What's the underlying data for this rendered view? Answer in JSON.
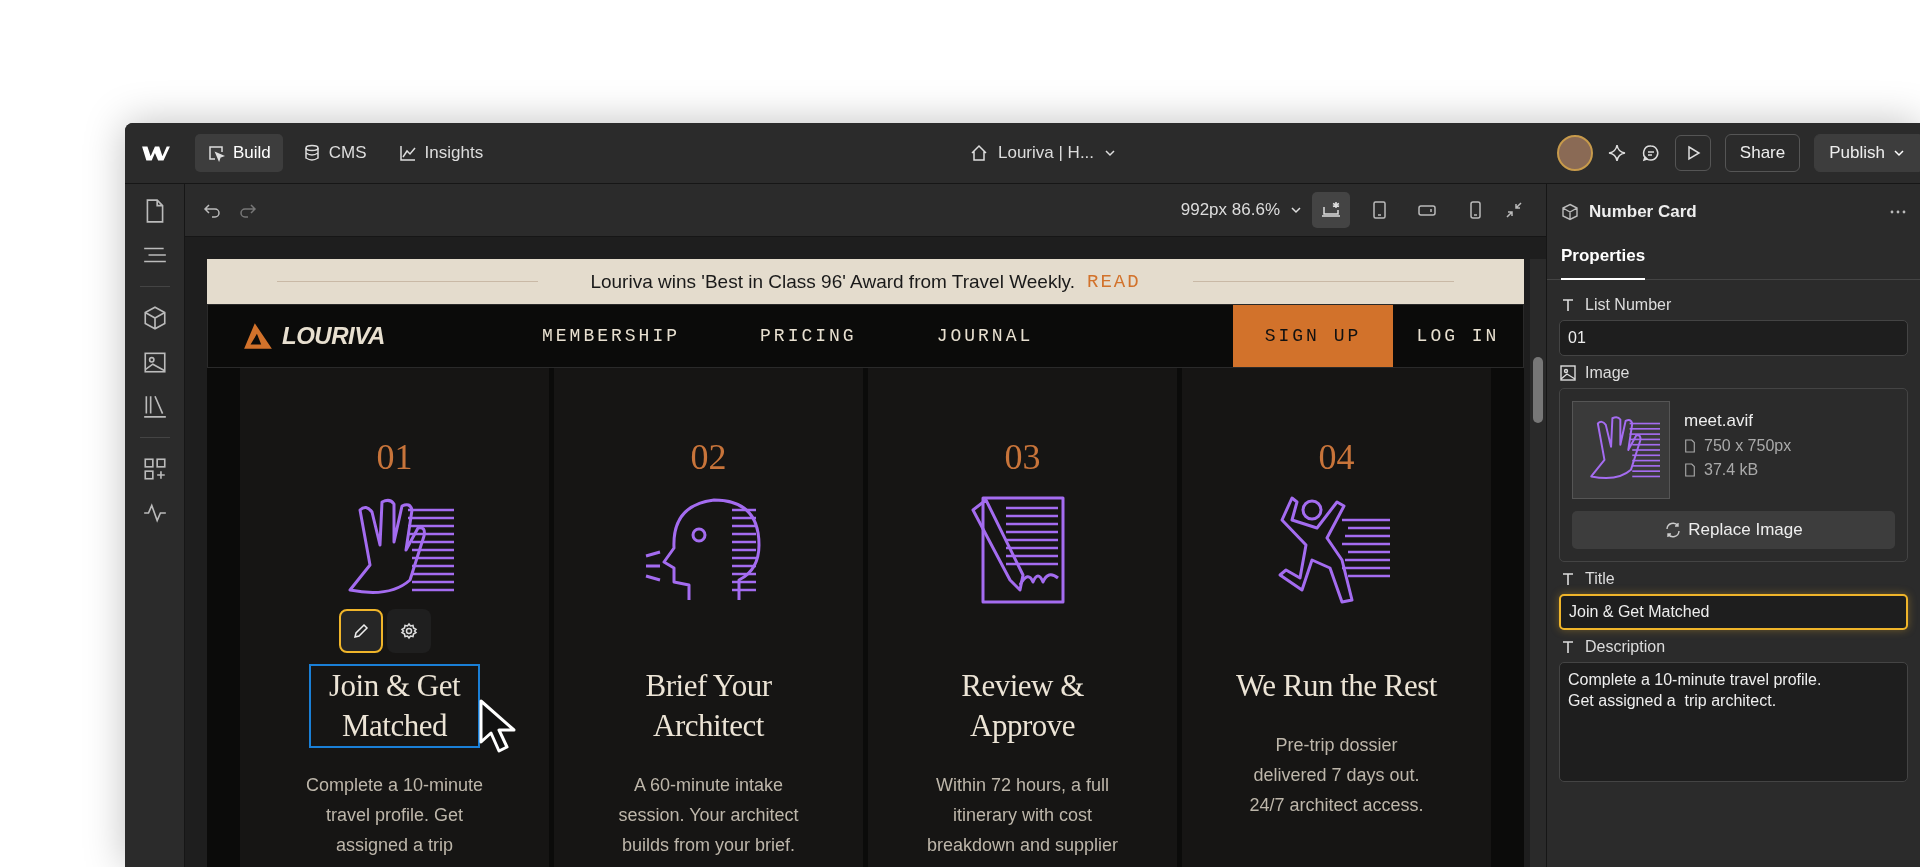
{
  "topbar": {
    "modes": [
      {
        "label": "Build",
        "kind": "build",
        "selected": true
      },
      {
        "label": "CMS",
        "kind": "cms",
        "selected": false
      },
      {
        "label": "Insights",
        "kind": "insights",
        "selected": false
      }
    ],
    "page_title": "Louriva | H...",
    "share": "Share",
    "publish": "Publish"
  },
  "canvas_toolbar": {
    "size": "992px 86.6%",
    "breakpoints": [
      {
        "kind": "desktop",
        "selected": true
      },
      {
        "kind": "tablet",
        "selected": false
      },
      {
        "kind": "landscape",
        "selected": false
      },
      {
        "kind": "phone",
        "selected": false
      }
    ]
  },
  "site": {
    "banner": {
      "text": "Louriva wins 'Best in Class 96' Award from Travel Weekly.",
      "link": "READ"
    },
    "logo": "LOURIVA",
    "nav": [
      "MEMBERSHIP",
      "PRICING",
      "JOURNAL"
    ],
    "signup": "SIGN UP",
    "login": "LOG IN",
    "cards": [
      {
        "number": "01",
        "kind": "hands",
        "title": "Join & Get\nMatched",
        "description": "Complete a 10-minute\ntravel profile. Get\nassigned a trip",
        "selected": true
      },
      {
        "number": "02",
        "kind": "head",
        "title": "Brief Your\nArchitect",
        "description": "A 60-minute intake\nsession. Your architect\nbuilds from your brief.",
        "selected": false
      },
      {
        "number": "03",
        "kind": "document",
        "title": "Review &\nApprove",
        "description": "Within 72 hours, a full\nitinerary with cost\nbreakdown and supplier",
        "selected": false
      },
      {
        "number": "04",
        "kind": "runner",
        "title": "We Run the Rest",
        "description": "Pre-trip dossier\ndelivered 7 days out.\n24/7 architect access.",
        "selected": false
      }
    ]
  },
  "panel": {
    "component": "Number Card",
    "tabs": [
      {
        "label": "Properties",
        "selected": true
      }
    ],
    "fields": [
      {
        "kind": "text",
        "label": "List Number",
        "value": "01",
        "focused": false
      },
      {
        "kind": "image",
        "label": "Image",
        "file": "meet.avif",
        "dimensions": "750 x 750px",
        "size": "37.4 kB",
        "button": "Replace Image"
      },
      {
        "kind": "text",
        "label": "Title",
        "value": "Join & Get Matched",
        "focused": true
      },
      {
        "kind": "textarea",
        "label": "Description",
        "value": "Complete a 10-minute travel profile.\nGet assigned a  trip architect."
      }
    ]
  }
}
